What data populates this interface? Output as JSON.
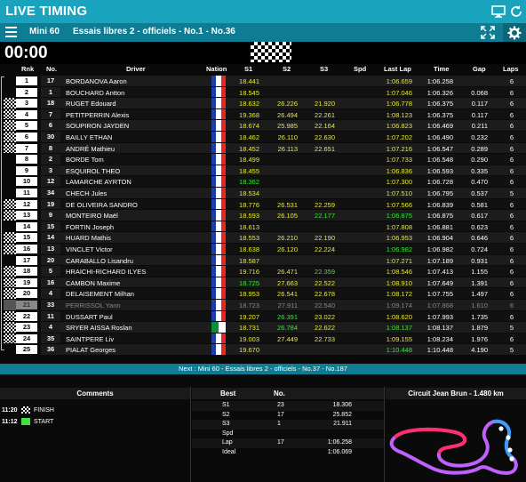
{
  "app": {
    "title": "LIVE TIMING"
  },
  "session": {
    "category": "Mini 60",
    "name": "Essais libres 2 - officiels - No.1 - No.36",
    "timer": "00:00"
  },
  "columns": [
    "Rnk",
    "No.",
    "Driver",
    "Nation",
    "S1",
    "S2",
    "S3",
    "Spd",
    "Last Lap",
    "Time",
    "Gap",
    "Laps"
  ],
  "colors": {
    "accent": "#1aa3bd",
    "subbar": "#0e7d93",
    "yellow": "#e8e83a",
    "green": "#3fe23f",
    "purple": "#c060ff"
  },
  "rows": [
    {
      "rnk": "1",
      "no": "17",
      "driver": "BORDANOVA Aaron",
      "s1": "18.441",
      "s2": "",
      "s3": "",
      "last": "1:06.659",
      "time": "1:06.258",
      "gap": "",
      "laps": "6",
      "flag": "",
      "s1c": "y",
      "s2c": "",
      "s3c": "",
      "lc": "y"
    },
    {
      "rnk": "2",
      "no": "1",
      "driver": "BOUCHARD Antton",
      "s1": "18.545",
      "s2": "",
      "s3": "",
      "last": "1:07.046",
      "time": "1:06.326",
      "gap": "0.068",
      "laps": "6",
      "flag": "",
      "s1c": "y",
      "s2c": "",
      "s3c": "",
      "lc": "y"
    },
    {
      "rnk": "3",
      "no": "18",
      "driver": "RUGET Edouard",
      "s1": "18.632",
      "s2": "26.226",
      "s3": "21.920",
      "last": "1:06.778",
      "time": "1:06.375",
      "gap": "0.117",
      "laps": "6",
      "flag": "pit",
      "s1c": "y",
      "s2c": "y",
      "s3c": "y",
      "lc": "y"
    },
    {
      "rnk": "4",
      "no": "7",
      "driver": "PETITPERRIN Alexis",
      "s1": "19.368",
      "s2": "26.494",
      "s3": "22.261",
      "last": "1:08.123",
      "time": "1:06.375",
      "gap": "0.117",
      "laps": "6",
      "flag": "pit",
      "s1c": "y",
      "s2c": "y",
      "s3c": "y",
      "lc": "y"
    },
    {
      "rnk": "5",
      "no": "6",
      "driver": "SOUPIRON JAYDEN",
      "s1": "18.674",
      "s2": "25.985",
      "s3": "22.164",
      "last": "1:06.823",
      "time": "1:06.469",
      "gap": "0.211",
      "laps": "6",
      "flag": "pit",
      "s1c": "y",
      "s2c": "y",
      "s3c": "y",
      "lc": "y"
    },
    {
      "rnk": "6",
      "no": "30",
      "driver": "BAILLY ETHAN",
      "s1": "18.462",
      "s2": "26.110",
      "s3": "22.630",
      "last": "1:07.202",
      "time": "1:06.490",
      "gap": "0.232",
      "laps": "6",
      "flag": "pit",
      "s1c": "y",
      "s2c": "y",
      "s3c": "y",
      "lc": "y"
    },
    {
      "rnk": "7",
      "no": "8",
      "driver": "ANDRÉ Mathieu",
      "s1": "18.452",
      "s2": "26.113",
      "s3": "22.651",
      "last": "1:07.216",
      "time": "1:06.547",
      "gap": "0.289",
      "laps": "6",
      "flag": "pit",
      "s1c": "y",
      "s2c": "y",
      "s3c": "y",
      "lc": "y"
    },
    {
      "rnk": "8",
      "no": "2",
      "driver": "BORDE Tom",
      "s1": "18.499",
      "s2": "",
      "s3": "",
      "last": "1:07.733",
      "time": "1:06.548",
      "gap": "0.290",
      "laps": "6",
      "flag": "",
      "s1c": "y",
      "s2c": "",
      "s3c": "",
      "lc": "y"
    },
    {
      "rnk": "9",
      "no": "3",
      "driver": "ESQUIROL THEO",
      "s1": "18.455",
      "s2": "",
      "s3": "",
      "last": "1:06.836",
      "time": "1:06.593",
      "gap": "0.335",
      "laps": "6",
      "flag": "",
      "s1c": "y",
      "s2c": "",
      "s3c": "",
      "lc": "y"
    },
    {
      "rnk": "10",
      "no": "12",
      "driver": "LAMARCHE AYRTON",
      "s1": "18.362",
      "s2": "",
      "s3": "",
      "last": "1:07.300",
      "time": "1:06.728",
      "gap": "0.470",
      "laps": "6",
      "flag": "",
      "s1c": "g",
      "s2c": "",
      "s3c": "",
      "lc": "y"
    },
    {
      "rnk": "11",
      "no": "34",
      "driver": "CHECH Jules",
      "s1": "18.534",
      "s2": "",
      "s3": "",
      "last": "1:07.510",
      "time": "1:06.795",
      "gap": "0.537",
      "laps": "5",
      "flag": "",
      "s1c": "y",
      "s2c": "",
      "s3c": "",
      "lc": "y"
    },
    {
      "rnk": "12",
      "no": "19",
      "driver": "DE OLIVEIRA SANDRO",
      "s1": "18.776",
      "s2": "26.531",
      "s3": "22.259",
      "last": "1:07.566",
      "time": "1:06.839",
      "gap": "0.581",
      "laps": "6",
      "flag": "pit",
      "s1c": "y",
      "s2c": "y",
      "s3c": "y",
      "lc": "y"
    },
    {
      "rnk": "13",
      "no": "9",
      "driver": "MONTEIRO Maël",
      "s1": "18.593",
      "s2": "26.105",
      "s3": "22.177",
      "last": "1:06.875",
      "time": "1:06.875",
      "gap": "0.617",
      "laps": "6",
      "flag": "pit",
      "s1c": "y",
      "s2c": "y",
      "s3c": "g",
      "lc": "g"
    },
    {
      "rnk": "14",
      "no": "15",
      "driver": "FORTIN Joseph",
      "s1": "18.613",
      "s2": "",
      "s3": "",
      "last": "1:07.808",
      "time": "1:06.881",
      "gap": "0.623",
      "laps": "6",
      "flag": "",
      "s1c": "y",
      "s2c": "",
      "s3c": "",
      "lc": "y"
    },
    {
      "rnk": "15",
      "no": "14",
      "driver": "HUARD Mathis",
      "s1": "18.553",
      "s2": "26.210",
      "s3": "22.190",
      "last": "1:06.953",
      "time": "1:06.904",
      "gap": "0.646",
      "laps": "6",
      "flag": "pit",
      "s1c": "y",
      "s2c": "y",
      "s3c": "y",
      "lc": "y"
    },
    {
      "rnk": "16",
      "no": "13",
      "driver": "VINCLET Victor",
      "s1": "18.638",
      "s2": "26.120",
      "s3": "22.224",
      "last": "1:06.982",
      "time": "1:06.982",
      "gap": "0.724",
      "laps": "6",
      "flag": "pit",
      "s1c": "y",
      "s2c": "y",
      "s3c": "y",
      "lc": "g"
    },
    {
      "rnk": "17",
      "no": "20",
      "driver": "CARABALLO Lisandru",
      "s1": "18.587",
      "s2": "",
      "s3": "",
      "last": "1:07.271",
      "time": "1:07.189",
      "gap": "0.931",
      "laps": "6",
      "flag": "",
      "s1c": "y",
      "s2c": "",
      "s3c": "",
      "lc": "y"
    },
    {
      "rnk": "18",
      "no": "5",
      "driver": "HRAICHI-RICHARD ILYES",
      "s1": "19.716",
      "s2": "26.471",
      "s3": "22.359",
      "last": "1:08.546",
      "time": "1:07.413",
      "gap": "1.155",
      "laps": "6",
      "flag": "pit",
      "s1c": "y",
      "s2c": "y",
      "s3c": "g",
      "lc": "y"
    },
    {
      "rnk": "19",
      "no": "16",
      "driver": "CAMBON Maxime",
      "s1": "18.725",
      "s2": "27.663",
      "s3": "22.522",
      "last": "1:08.910",
      "time": "1:07.649",
      "gap": "1.391",
      "laps": "6",
      "flag": "pit",
      "s1c": "g",
      "s2c": "y",
      "s3c": "y",
      "lc": "y"
    },
    {
      "rnk": "20",
      "no": "4",
      "driver": "DELAISEMENT Milhan",
      "s1": "18.953",
      "s2": "26.541",
      "s3": "22.678",
      "last": "1:08.172",
      "time": "1:07.755",
      "gap": "1.497",
      "laps": "6",
      "flag": "pit",
      "s1c": "y",
      "s2c": "y",
      "s3c": "y",
      "lc": "y"
    },
    {
      "rnk": "21",
      "no": "33",
      "driver": "PERRISSOL Yann",
      "s1": "18.723",
      "s2": "27.911",
      "s3": "22.540",
      "last": "1:09.174",
      "time": "1:07.868",
      "gap": "1.610",
      "laps": "6",
      "flag": "dim",
      "s1c": "",
      "s2c": "",
      "s3c": "",
      "lc": ""
    },
    {
      "rnk": "22",
      "no": "11",
      "driver": "DUSSART Paul",
      "s1": "19.207",
      "s2": "26.391",
      "s3": "23.022",
      "last": "1:08.620",
      "time": "1:07.993",
      "gap": "1.735",
      "laps": "6",
      "flag": "pit",
      "s1c": "y",
      "s2c": "g",
      "s3c": "y",
      "lc": "y"
    },
    {
      "rnk": "23",
      "no": "4",
      "driver": "SRYER AISSA Roslan",
      "s1": "18.731",
      "s2": "26.784",
      "s3": "22.622",
      "last": "1:08.137",
      "time": "1:08.137",
      "gap": "1.879",
      "laps": "5",
      "flag": "pit",
      "s1c": "y",
      "s2c": "g",
      "s3c": "y",
      "lc": "g",
      "nation": "dz"
    },
    {
      "rnk": "24",
      "no": "35",
      "driver": "SAINTPERE Liv",
      "s1": "19.003",
      "s2": "27.449",
      "s3": "22.733",
      "last": "1:09.155",
      "time": "1:08.234",
      "gap": "1.976",
      "laps": "6",
      "flag": "pit",
      "s1c": "y",
      "s2c": "y",
      "s3c": "y",
      "lc": "y"
    },
    {
      "rnk": "25",
      "no": "36",
      "driver": "PIALAT Georges",
      "s1": "19.670",
      "s2": "",
      "s3": "",
      "last": "1:10.448",
      "time": "1:10.448",
      "gap": "4.190",
      "laps": "5",
      "flag": "",
      "s1c": "y",
      "s2c": "",
      "s3c": "",
      "lc": "g"
    }
  ],
  "next": "Next : Mini 60 - Essais libres 2 - officiels - No.37 - No.187",
  "comments_panel": {
    "title": "Comments",
    "items": [
      {
        "time": "11:20",
        "icon": "checkered-flag-icon",
        "text": "FINISH"
      },
      {
        "time": "11:12",
        "icon": "green-flag-icon",
        "text": "START"
      }
    ]
  },
  "best_panel": {
    "title": "Best",
    "no_label": "No.",
    "rows": [
      {
        "label": "S1",
        "no": "23",
        "value": "18.306"
      },
      {
        "label": "S2",
        "no": "17",
        "value": "25.852"
      },
      {
        "label": "S3",
        "no": "1",
        "value": "21.911"
      },
      {
        "label": "Spd",
        "no": "",
        "value": ""
      },
      {
        "label": "Lap",
        "no": "17",
        "value": "1:06.258"
      },
      {
        "label": "Ideal",
        "no": "",
        "value": "1:06.069"
      }
    ]
  },
  "circuit": {
    "title": "Circuit Jean Brun - 1.480 km"
  }
}
